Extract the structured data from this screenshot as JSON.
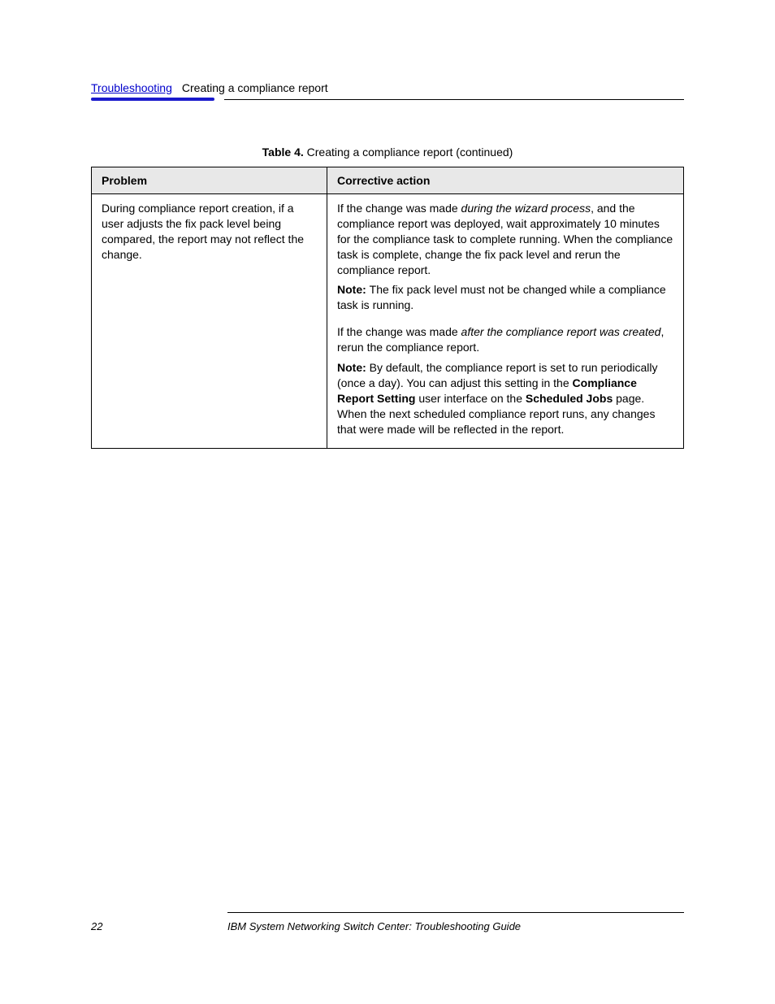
{
  "header": {
    "link_text": "Troubleshooting",
    "right_text": "Creating a compliance report"
  },
  "table": {
    "caption_label": "Table 4.",
    "caption_title": "Creating a compliance report (continued)",
    "th_problem": "Problem",
    "th_action": "Corrective action",
    "row": {
      "problem": "During compliance report creation, if a user adjusts the fix pack level being compared, the report may not reflect the change.",
      "action1": {
        "body_prefix": "If the change was made ",
        "body_emph": "during the wizard process",
        "body_suffix": ", and the compliance report was deployed, wait approximately 10 minutes for the compliance task to complete running. When the compliance task is complete, change the fix pack level and rerun the compliance report.",
        "note_label": "Note: ",
        "note_body": "The fix pack level must not be changed while a compliance task is running."
      },
      "action2": {
        "body_prefix": "If the change was made ",
        "body_emph": "after the compliance report was created",
        "body_suffix": ", rerun the compliance report.",
        "note_label": "Note: ",
        "note_prefix": "By default, the compliance report is set to run periodically (once a day). You can adjust this setting in the ",
        "note_emph1": "Compliance Report Setting",
        "note_mid": " user interface on the ",
        "note_emph2": "Scheduled Jobs",
        "note_suffix": " page. When the next scheduled compliance report runs, any changes that were made will be reflected in the report."
      }
    }
  },
  "footer": {
    "page_no": "22",
    "doc_title": "IBM System Networking Switch Center: Troubleshooting Guide"
  }
}
